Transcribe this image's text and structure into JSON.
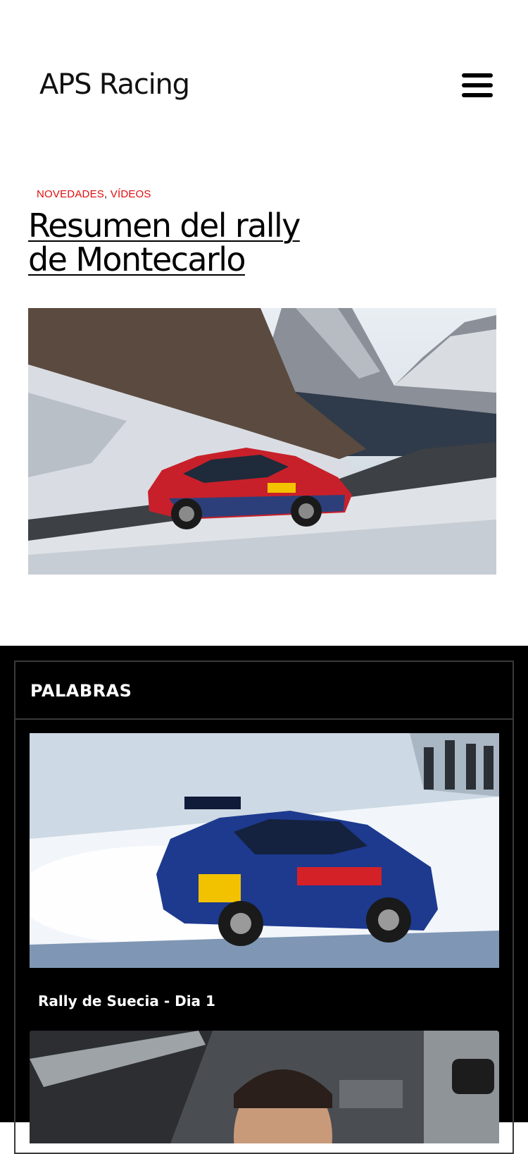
{
  "header": {
    "site_title": "APS Racing",
    "menu_icon": "hamburger-menu-icon"
  },
  "post": {
    "categories": [
      "NOVEDADES",
      "VÍDEOS"
    ],
    "category_separator": ",",
    "title": "Resumen del rally de Montecarlo",
    "image_alt": "Rally car on snowy mountain road"
  },
  "widget": {
    "title": "PALABRAS",
    "items": [
      {
        "title": "Rally de Suecia - Dia 1",
        "image_alt": "Blue rally car in snow"
      },
      {
        "title": "",
        "image_alt": "Driver inside rally car"
      }
    ]
  },
  "colors": {
    "accent": "#e00d0d",
    "dark_background": "#000000",
    "widget_border": "#3a3a3a"
  }
}
